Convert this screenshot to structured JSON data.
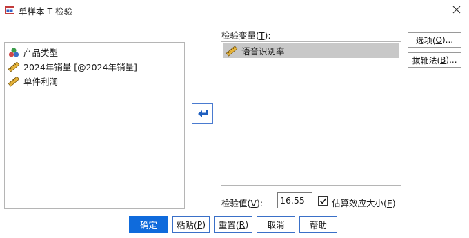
{
  "window": {
    "title": "单样本 T 检验",
    "app_icon": "spss-dialog-icon",
    "close_icon": "close-icon"
  },
  "source_list": {
    "items": [
      {
        "label": "产品类型",
        "icon": "nominal-variable-icon"
      },
      {
        "label": "2024年销量 [@2024年销量]",
        "icon": "scale-variable-icon"
      },
      {
        "label": "单件利润",
        "icon": "scale-variable-icon"
      }
    ]
  },
  "target_list": {
    "label_prefix": "检验变量(",
    "label_key": "T",
    "label_suffix": "):",
    "items": [
      {
        "label": "语音识别率",
        "icon": "scale-variable-icon",
        "selected": true
      }
    ]
  },
  "move_button": {
    "icon": "arrow-move-icon"
  },
  "side_buttons": {
    "options": {
      "prefix": "选项(",
      "key": "O",
      "suffix": ")..."
    },
    "bootstrap": {
      "prefix": "拔靴法(",
      "key": "B",
      "suffix": ")..."
    }
  },
  "test_value": {
    "label_prefix": "检验值(",
    "label_key": "V",
    "label_suffix": "):",
    "value": "16.55"
  },
  "effect_size": {
    "checked": true,
    "label_prefix": "估算效应大小(",
    "label_key": "E",
    "label_suffix": ")"
  },
  "buttons": {
    "ok": "确定",
    "paste": {
      "prefix": "粘贴(",
      "key": "P",
      "suffix": ")"
    },
    "reset": {
      "prefix": "重置(",
      "key": "R",
      "suffix": ")"
    },
    "cancel": "取消",
    "help": "帮助"
  },
  "colors": {
    "primary": "#0f6bdc",
    "selection": "#c8c8c8",
    "move_arrow": "#1f5fbf"
  }
}
